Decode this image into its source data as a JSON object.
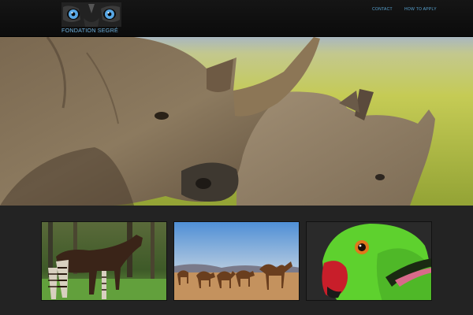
{
  "site": {
    "logo_text": "FONDATION SEGRÉ"
  },
  "nav": {
    "items": [
      {
        "label": "CONTACT"
      },
      {
        "label": "HOW TO APPLY"
      }
    ]
  },
  "hero": {
    "subject": "white rhinoceroses"
  },
  "gallery": {
    "items": [
      {
        "subject": "okapi"
      },
      {
        "subject": "camels in desert"
      },
      {
        "subject": "green parrot"
      }
    ]
  },
  "colors": {
    "header_bg": "#111111",
    "nav_link": "#5aa7d6",
    "logo_text": "#6fb2de",
    "page_bg": "#232323"
  }
}
